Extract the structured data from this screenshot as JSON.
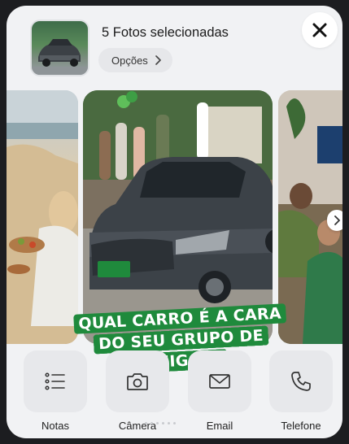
{
  "header": {
    "title": "5 Fotos selecionadas",
    "options_label": "Opções"
  },
  "carousel": {
    "headline_line1": "QUAL CARRO É A CARA",
    "headline_line2": "DO SEU GRUPO DE AMIGOS?"
  },
  "share_targets": [
    {
      "label": "Notas",
      "icon": "notes-icon"
    },
    {
      "label": "Câmera",
      "icon": "camera-icon"
    },
    {
      "label": "Email",
      "icon": "mail-icon"
    },
    {
      "label": "Telefone",
      "icon": "phone-icon"
    }
  ],
  "colors": {
    "sheet": "#f1f2f4",
    "button": "#e7e8eb",
    "headline_bg": "#1f8a3c"
  }
}
